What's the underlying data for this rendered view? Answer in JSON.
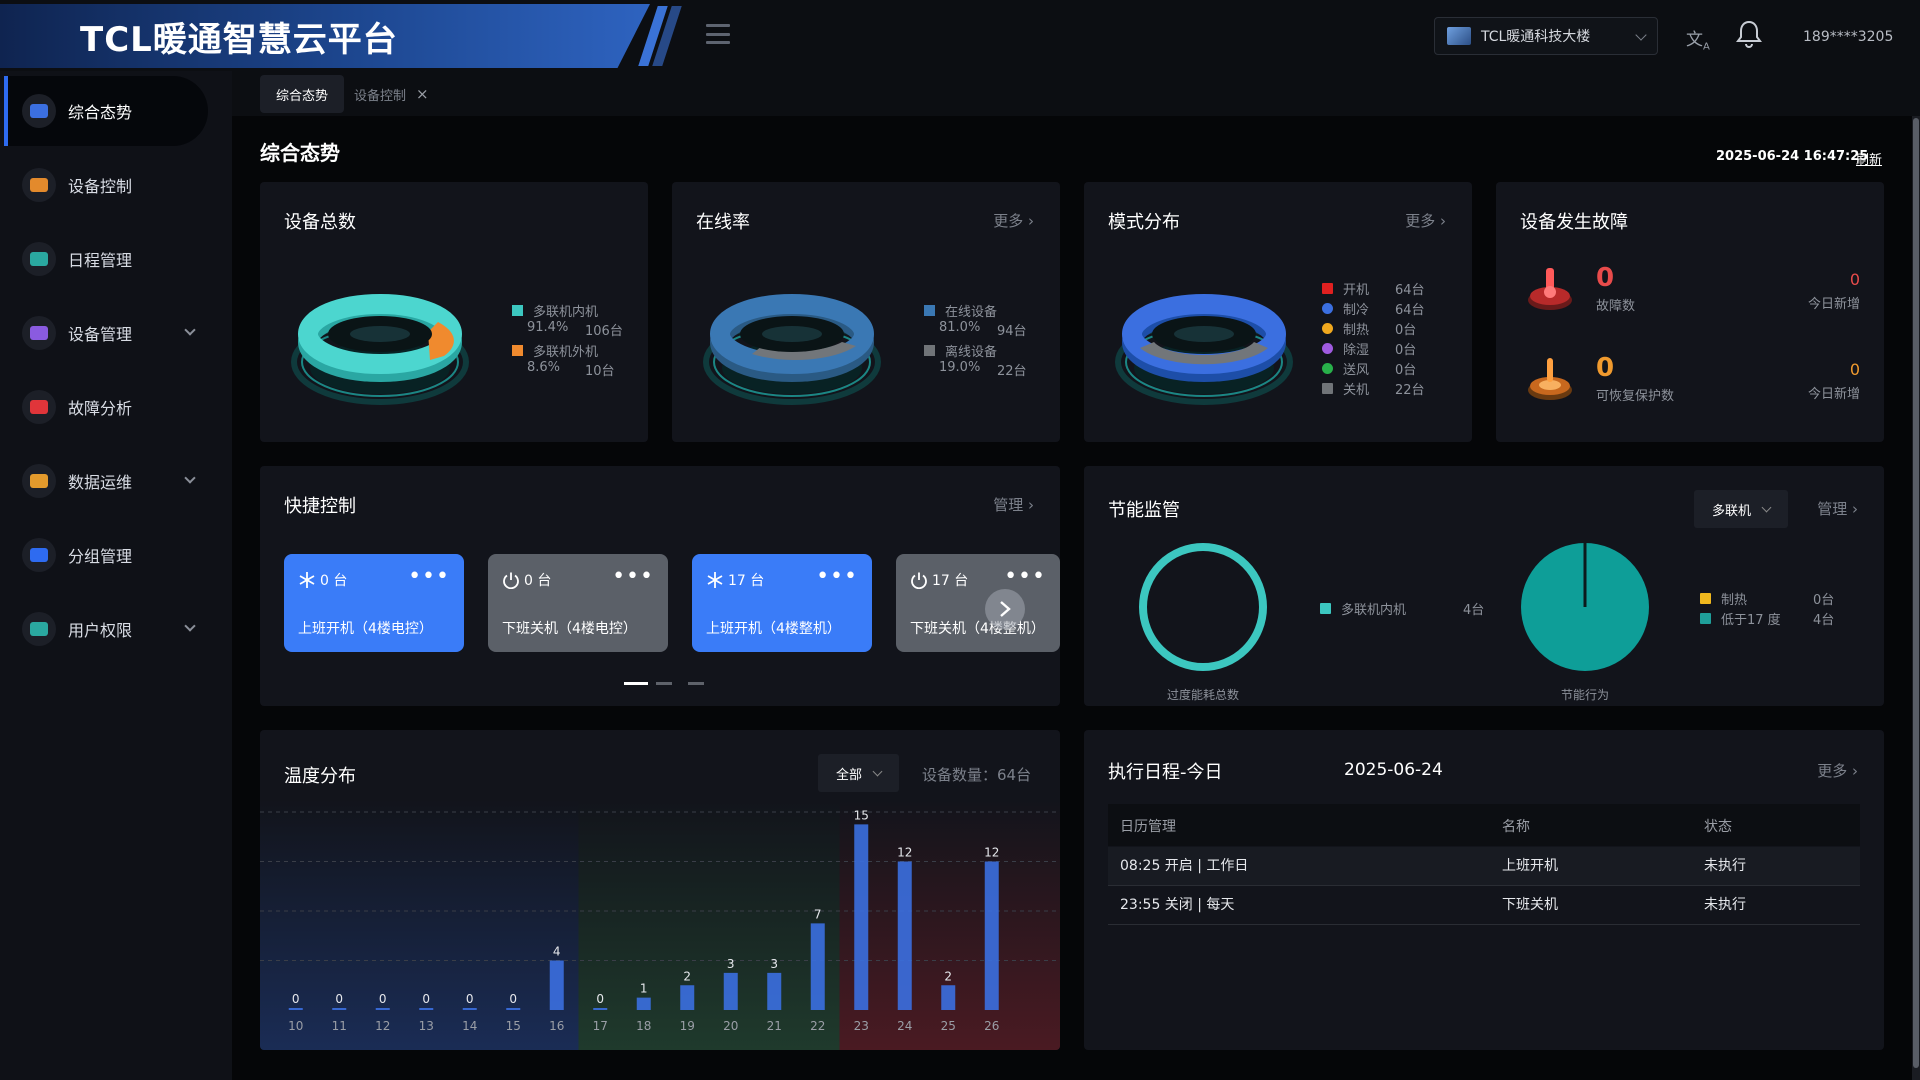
{
  "header": {
    "title": "TCL暖通智慧云平台",
    "building": "TCL暖通科技大楼",
    "user": "189****3205",
    "translate_icon": "translate-icon",
    "bell_icon": "bell-icon"
  },
  "sidebar": {
    "items": [
      {
        "label": "综合态势",
        "icon": "dashboard-icon",
        "active": true,
        "color": "#3b6fe0",
        "expand": false
      },
      {
        "label": "设备控制",
        "icon": "device-control-icon",
        "active": false,
        "color": "#e38a2c",
        "expand": false
      },
      {
        "label": "日程管理",
        "icon": "calendar-icon",
        "active": false,
        "color": "#2aa8a0",
        "expand": false
      },
      {
        "label": "设备管理",
        "icon": "device-manage-icon",
        "active": false,
        "color": "#8a5be0",
        "expand": true
      },
      {
        "label": "故障分析",
        "icon": "fault-icon",
        "active": false,
        "color": "#e0353a",
        "expand": false
      },
      {
        "label": "数据运维",
        "icon": "data-ops-icon",
        "active": false,
        "color": "#e39a2c",
        "expand": true
      },
      {
        "label": "分组管理",
        "icon": "group-icon",
        "active": false,
        "color": "#2e6bf0",
        "expand": false
      },
      {
        "label": "用户权限",
        "icon": "user-permission-icon",
        "active": false,
        "color": "#2aa8a0",
        "expand": true
      }
    ]
  },
  "tabs": [
    {
      "label": "综合态势",
      "active": true
    },
    {
      "label": "设备控制",
      "active": false,
      "close": "×"
    }
  ],
  "page": {
    "title": "综合态势",
    "timestamp": "2025-06-24 16:47:25",
    "refresh": "刷新"
  },
  "common": {
    "more": "更多",
    "manage": "管理"
  },
  "device_total": {
    "title": "设备总数",
    "legend": [
      {
        "label": "多联机内机",
        "pct": "91.4%",
        "count": "106台",
        "color": "#3cc7c0"
      },
      {
        "label": "多联机外机",
        "pct": "8.6%",
        "count": "10台",
        "color": "#f08a2e"
      }
    ]
  },
  "online_rate": {
    "title": "在线率",
    "legend": [
      {
        "label": "在线设备",
        "pct": "81.0%",
        "count": "94台",
        "color": "#3a78b4"
      },
      {
        "label": "离线设备",
        "pct": "19.0%",
        "count": "22台",
        "color": "#707478"
      }
    ]
  },
  "mode_dist": {
    "title": "模式分布",
    "legend": [
      {
        "label": "开机",
        "count": "64台",
        "color": "#e02020",
        "shape": "square"
      },
      {
        "label": "制冷",
        "count": "64台",
        "color": "#3b6fe0",
        "shape": "circle"
      },
      {
        "label": "制热",
        "count": "0台",
        "color": "#f0a81e",
        "shape": "circle"
      },
      {
        "label": "除湿",
        "count": "0台",
        "color": "#a05be0",
        "shape": "circle"
      },
      {
        "label": "送风",
        "count": "0台",
        "color": "#28b04a",
        "shape": "circle"
      },
      {
        "label": "关机",
        "count": "22台",
        "color": "#707478",
        "shape": "square"
      }
    ]
  },
  "fault": {
    "title": "设备发生故障",
    "items": [
      {
        "value": "0",
        "label": "故障数",
        "today_value": "0",
        "today_label": "今日新增",
        "color": "#e84b4b",
        "icon": "fault-alarm-icon"
      },
      {
        "value": "0",
        "label": "可恢复保护数",
        "today_value": "0",
        "today_label": "今日新增",
        "color": "#f09a2e",
        "icon": "protect-recover-icon"
      }
    ]
  },
  "quick": {
    "title": "快捷控制",
    "buttons": [
      {
        "count": "0 台",
        "label": "上班开机（4楼电控）",
        "icon": "snowflake-icon",
        "bg": "#3a7cf8"
      },
      {
        "count": "0 台",
        "label": "下班关机（4楼电控）",
        "icon": "power-icon",
        "bg": "#5b6068"
      },
      {
        "count": "17 台",
        "label": "上班开机（4楼整机）",
        "icon": "snowflake-icon",
        "bg": "#3a7cf8"
      },
      {
        "count": "17 台",
        "label": "下班关机（4楼整机）",
        "icon": "power-icon",
        "bg": "#5b6068"
      }
    ],
    "dots_label": "•••",
    "page_index": 0,
    "page_count": 3
  },
  "energy": {
    "title": "节能监管",
    "select": "多联机",
    "left_caption": "过度能耗总数",
    "right_caption": "节能行为",
    "left_legend": [
      {
        "label": "多联机内机",
        "count": "4台",
        "color": "#3cc7c0"
      }
    ],
    "right_legend": [
      {
        "label": "制热",
        "count": "0台",
        "color": "#f0b81e"
      },
      {
        "label": "低于17 度",
        "count": "4台",
        "color": "#1f9f9a"
      }
    ],
    "ring_color": "#3cc7c0",
    "pie_color": "#0e9e98"
  },
  "temp": {
    "title": "温度分布",
    "select": "全部",
    "device_count_label": "设备数量：",
    "device_count": "64台"
  },
  "schedule": {
    "title": "执行日程-今日",
    "date": "2025-06-24",
    "columns": [
      "日历管理",
      "名称",
      "状态"
    ],
    "rows": [
      [
        "08:25 开启 | 工作日",
        "上班开机",
        "未执行"
      ],
      [
        "23:55 关闭 | 每天",
        "下班关机",
        "未执行"
      ]
    ]
  },
  "chart_data": {
    "type": "bar",
    "title": "温度分布",
    "categories": [
      "10",
      "11",
      "12",
      "13",
      "14",
      "15",
      "16",
      "17",
      "18",
      "19",
      "20",
      "21",
      "22",
      "23",
      "24",
      "25",
      "26"
    ],
    "values": [
      0,
      0,
      0,
      0,
      0,
      0,
      4,
      0,
      1,
      2,
      3,
      3,
      7,
      15,
      12,
      2,
      12
    ],
    "ylim": [
      0,
      16
    ],
    "zones": [
      {
        "from": "10",
        "to": "16",
        "color": "#1a2c55"
      },
      {
        "from": "17",
        "to": "22",
        "color": "#1f3a2c"
      },
      {
        "from": "23",
        "to": "26",
        "color": "#4a1a22"
      }
    ],
    "bar_color": "#3b6fe0",
    "grid": true
  }
}
